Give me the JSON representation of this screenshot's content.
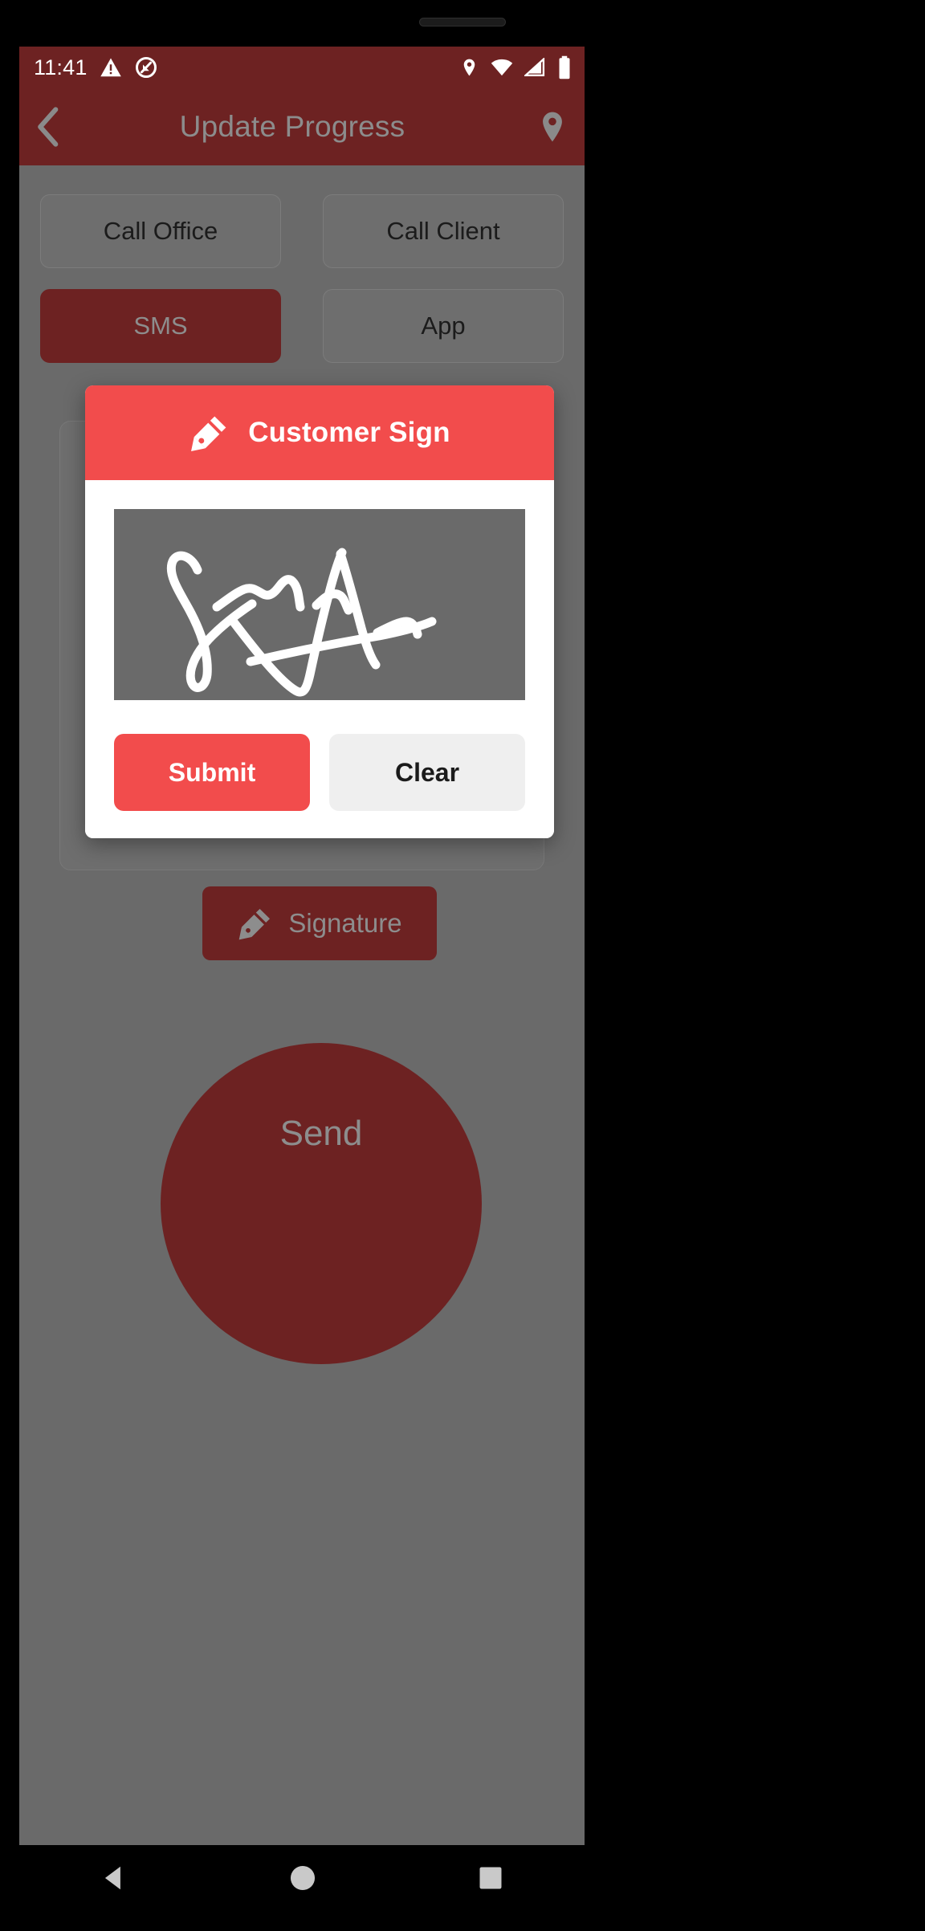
{
  "status_bar": {
    "time": "11:41",
    "icons": [
      "warning-triangle-icon",
      "do-not-disturb-icon",
      "location-pin-icon",
      "wifi-icon",
      "cell-signal-icon",
      "battery-icon"
    ]
  },
  "app_bar": {
    "back_icon": "chevron-left-icon",
    "title": "Update Progress",
    "action_icon": "location-pin-icon"
  },
  "content": {
    "buttons": [
      {
        "label": "Call Office",
        "style": "grey"
      },
      {
        "label": "Call Client",
        "style": "grey"
      },
      {
        "label": "SMS",
        "style": "dark-red"
      },
      {
        "label": "App",
        "style": "grey"
      }
    ],
    "signature_button": {
      "label": "Signature",
      "icon": "pen-nib-icon"
    },
    "send_button": {
      "label": "Send"
    }
  },
  "dialog": {
    "title": "Customer Sign",
    "icon": "pen-nib-icon",
    "canvas_label": "signature-drawing-area",
    "submit_label": "Submit",
    "clear_label": "Clear"
  },
  "nav_bar": {
    "back": "triangle-back-icon",
    "home": "circle-home-icon",
    "recents": "square-recents-icon"
  },
  "colors": {
    "app_bar": "#6d2222",
    "accent_red": "#f24c4c",
    "scrim_grey": "#6a6a6a",
    "clear_grey": "#efefef"
  }
}
